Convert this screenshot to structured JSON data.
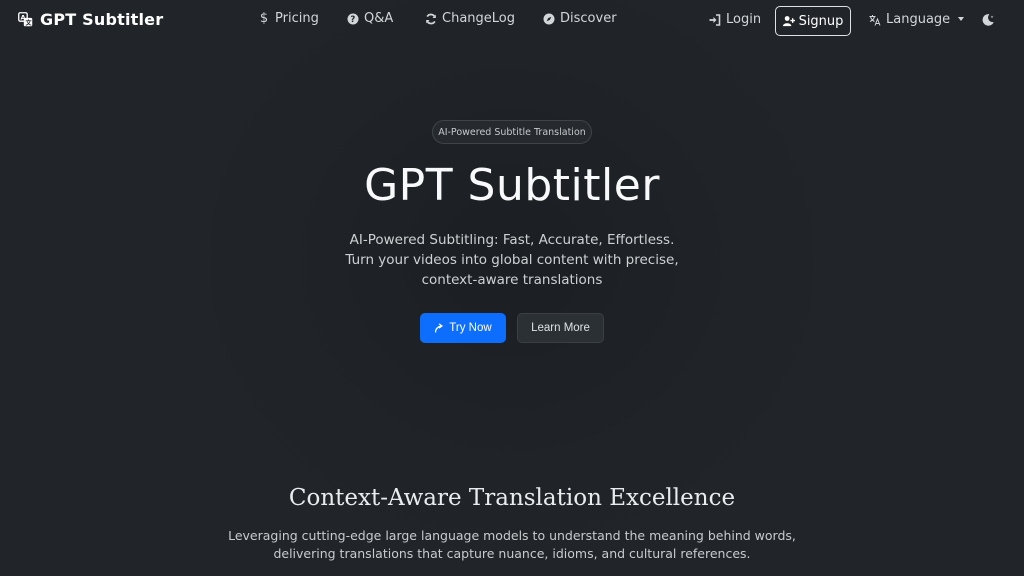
{
  "nav": {
    "brand": "GPT Subtitler",
    "pricing": "Pricing",
    "qa": "Q&A",
    "changelog": "ChangeLog",
    "discover": "Discover",
    "login": "Login",
    "signup": "Signup",
    "language": "Language",
    "icons": {
      "brand": "translate-icon",
      "pricing": "dollar-icon",
      "qa": "question-circle-icon",
      "changelog": "refresh-icon",
      "discover": "compass-icon",
      "login": "sign-in-icon",
      "signup": "user-plus-icon",
      "language": "language-icon",
      "theme": "moon-icon"
    }
  },
  "hero": {
    "badge": "AI-Powered Subtitle Translation",
    "title": "GPT Subtitler",
    "subtitle_line1": "AI-Powered Subtitling: Fast, Accurate, Effortless.",
    "subtitle_line2": "Turn your videos into global content with precise,",
    "subtitle_line3": "context-aware translations",
    "try_now": "Try Now",
    "learn_more": "Learn More"
  },
  "section": {
    "title": "Context-Aware Translation Excellence",
    "desc_line1": "Leveraging cutting-edge large language models to understand the meaning behind words,",
    "desc_line2": "delivering translations that capture nuance, idioms, and cultural references."
  },
  "colors": {
    "background": "#212529",
    "primary": "#0d6efd",
    "text": "#dee2e6"
  }
}
